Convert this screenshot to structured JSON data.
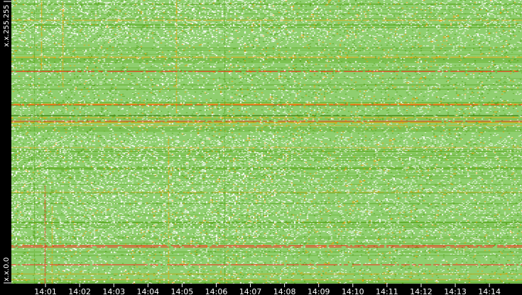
{
  "chart_data": {
    "type": "heatmap",
    "title": "",
    "xlabel": "",
    "ylabel": "",
    "x_ticks": [
      "14:01",
      "14:02",
      "14:03",
      "14:04",
      "14:05",
      "14:06",
      "14:07",
      "14:08",
      "14:09",
      "14:10",
      "14:11",
      "14:12",
      "14:13",
      "14:14"
    ],
    "xlim": [
      "14:00",
      "14:15"
    ],
    "y_labels": {
      "top": "x.x.255.255",
      "bottom": "x.x.0.0"
    },
    "ylim": [
      "x.x.0.0",
      "x.x.255.255"
    ],
    "grid": false,
    "legend": "none",
    "colors": {
      "background": "#000000",
      "empty": "#ffffff",
      "low": "#8fcf6f",
      "mid": "#5aa81e",
      "high": "#f5a000",
      "peak": "#ff2a1a"
    }
  }
}
